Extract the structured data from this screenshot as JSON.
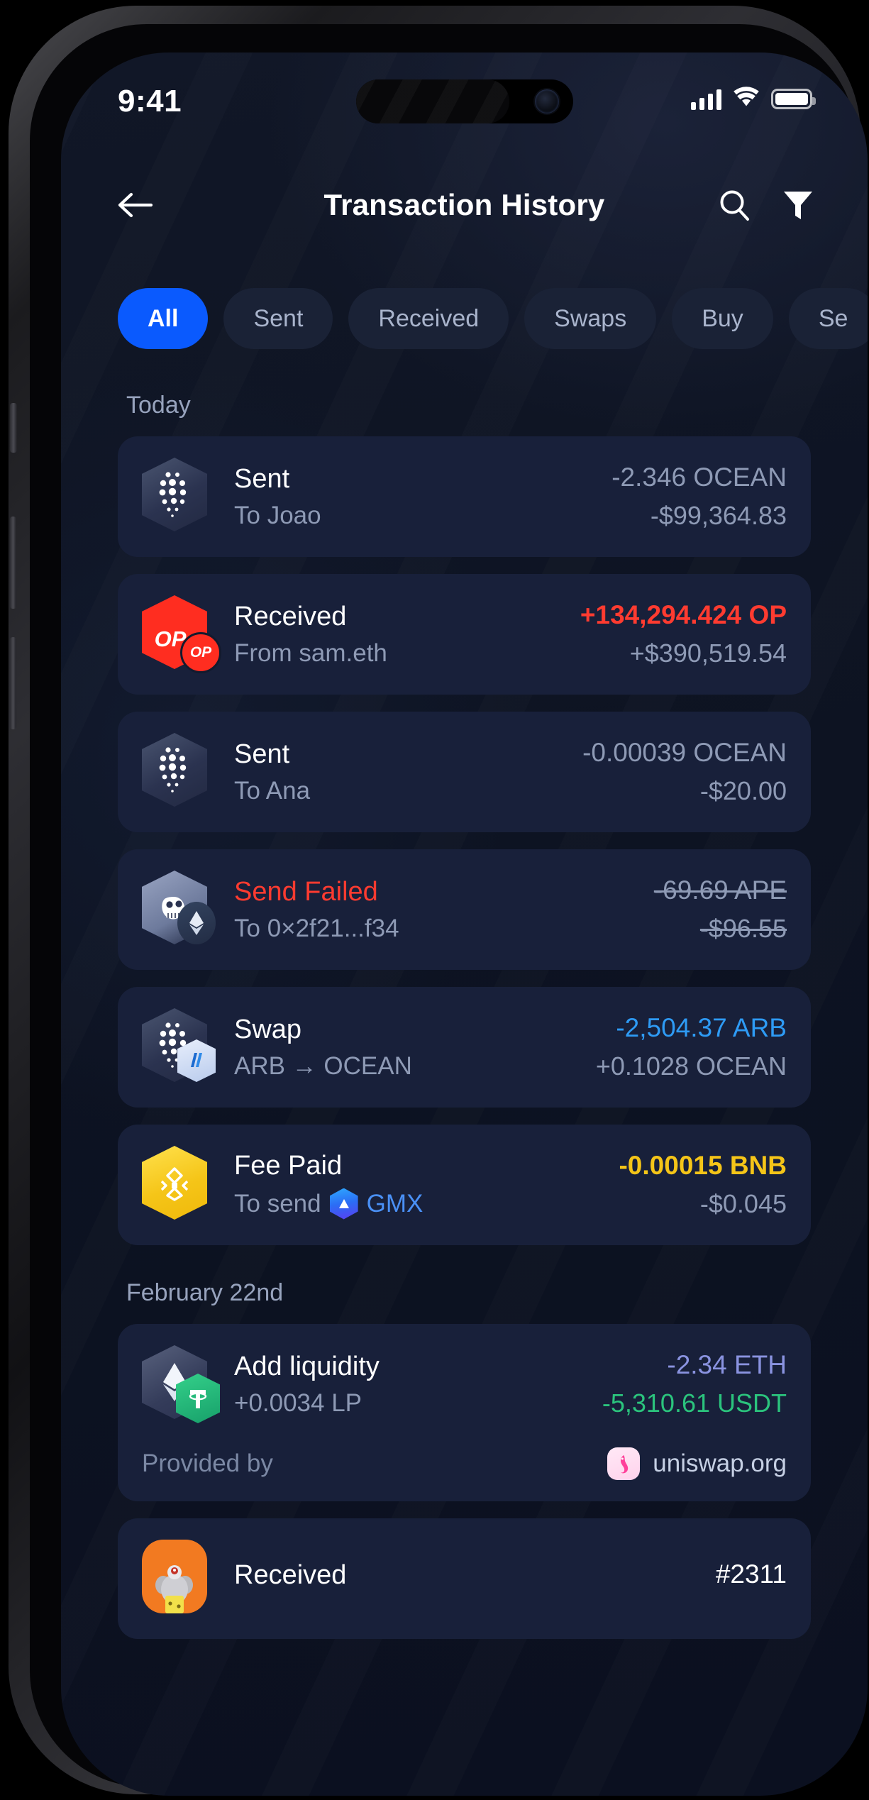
{
  "status_bar": {
    "time": "9:41",
    "signal_icon": "cellular-signal-icon",
    "wifi_icon": "wifi-icon",
    "battery_icon": "battery-full-icon"
  },
  "header": {
    "back_icon": "back-arrow-icon",
    "title": "Transaction History",
    "search_icon": "search-icon",
    "filter_icon": "filter-funnel-icon"
  },
  "filters": {
    "chips": [
      {
        "label": "All",
        "active": true
      },
      {
        "label": "Sent",
        "active": false
      },
      {
        "label": "Received",
        "active": false
      },
      {
        "label": "Swaps",
        "active": false
      },
      {
        "label": "Buy",
        "active": false
      },
      {
        "label": "Se",
        "active": false
      }
    ],
    "active_color": "#0a5afe"
  },
  "sections": [
    {
      "label": "Today",
      "transactions": [
        {
          "title": "Sent",
          "subtitle": "To Joao",
          "amount": "-2.346 OCEAN",
          "fiat": "-$99,364.83",
          "amount_color": "#8e9ab5",
          "fiat_color": "#8e9ab5",
          "title_color": "#ffffff",
          "token_icon": "ocean-token-icon",
          "failed": false
        },
        {
          "title": "Received",
          "subtitle": "From sam.eth",
          "amount": "+134,294.424 OP",
          "fiat": "+$390,519.54",
          "amount_color": "#ff3b30",
          "fiat_color": "#8e9ab5",
          "title_color": "#ffffff",
          "token_icon": "optimism-token-icon",
          "failed": false
        },
        {
          "title": "Sent",
          "subtitle": "To Ana",
          "amount": "-0.00039 OCEAN",
          "fiat": "-$20.00",
          "amount_color": "#8e9ab5",
          "fiat_color": "#8e9ab5",
          "title_color": "#ffffff",
          "token_icon": "ocean-token-icon",
          "failed": false
        },
        {
          "title": "Send Failed",
          "subtitle": "To 0×2f21...f34",
          "amount": "-69.69 APE",
          "fiat": "-$96.55",
          "amount_color": "#8e9ab5",
          "fiat_color": "#8e9ab5",
          "title_color": "#ff3b30",
          "token_icon": "apecoin-token-icon",
          "badge_icon": "ethereum-chain-badge",
          "failed": true
        },
        {
          "title": "Swap",
          "subtitle": "ARB → OCEAN",
          "amount": "-2,504.37 ARB",
          "fiat": "+0.1028 OCEAN",
          "amount_color": "#2e9bf5",
          "fiat_color": "#8e9ab5",
          "title_color": "#ffffff",
          "token_icon": "ocean-token-icon",
          "badge_icon": "arbitrum-chain-badge",
          "failed": false
        },
        {
          "title": "Fee Paid",
          "subtitle_prefix": "To send",
          "subtitle_link": "GMX",
          "subtitle": "To send GMX",
          "amount": "-0.00015 BNB",
          "fiat": "-$0.045",
          "amount_color": "#f5c518",
          "fiat_color": "#8e9ab5",
          "title_color": "#ffffff",
          "token_icon": "bnb-token-icon",
          "link_icon": "gmx-token-icon",
          "link_color": "#4a90f5",
          "failed": false
        }
      ]
    },
    {
      "label": "February 22nd",
      "transactions": [
        {
          "title": "Add liquidity",
          "subtitle": "+0.0034 LP",
          "amount": "-2.34 ETH",
          "fiat": "-5,310.61 USDT",
          "amount_color": "#8a93e0",
          "fiat_color": "#2bc47d",
          "title_color": "#ffffff",
          "token_icon": "ethereum-token-icon",
          "badge_icon": "tether-token-badge",
          "failed": false,
          "provided_by_label": "Provided by",
          "provider_name": "uniswap.org",
          "provider_icon": "uniswap-logo-icon"
        },
        {
          "title": "Received",
          "subtitle": "",
          "amount": "#2311",
          "fiat": "",
          "amount_color": "#ffffff",
          "fiat_color": "#8e9ab5",
          "title_color": "#ffffff",
          "token_icon": "nft-mouse-icon",
          "failed": false
        }
      ]
    }
  ]
}
